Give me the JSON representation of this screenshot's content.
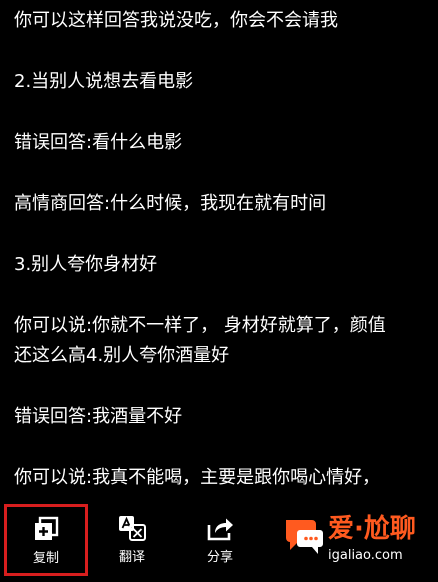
{
  "content": {
    "lines": [
      "你可以这样回答我说没吃，你会不会请我",
      "2.当别人说想去看电影",
      "错误回答:看什么电影",
      "高情商回答:什么时候，我现在就有时间",
      "3.别人夸你身材好",
      "你可以说:你就不一样了， 身材好就算了，颜值",
      "还这么高4.别人夸你酒量好",
      "错误回答:我酒量不好",
      "你可以说:我真不能喝，主要是跟你喝心情好，"
    ]
  },
  "bottom_bar": {
    "copy_label": "复制",
    "translate_label": "翻译",
    "share_label": "分享"
  },
  "watermark": {
    "text": "爱·尬聊",
    "url": "igaliao.com",
    "color": "#ff5a1f"
  },
  "colors": {
    "background": "#000000",
    "text": "#ffffff",
    "highlight_border": "#d81e1e"
  },
  "icons": {
    "copy": "copy-icon",
    "translate": "translate-icon",
    "share": "share-icon",
    "watermark_logo": "chat-bubble-logo-icon"
  }
}
